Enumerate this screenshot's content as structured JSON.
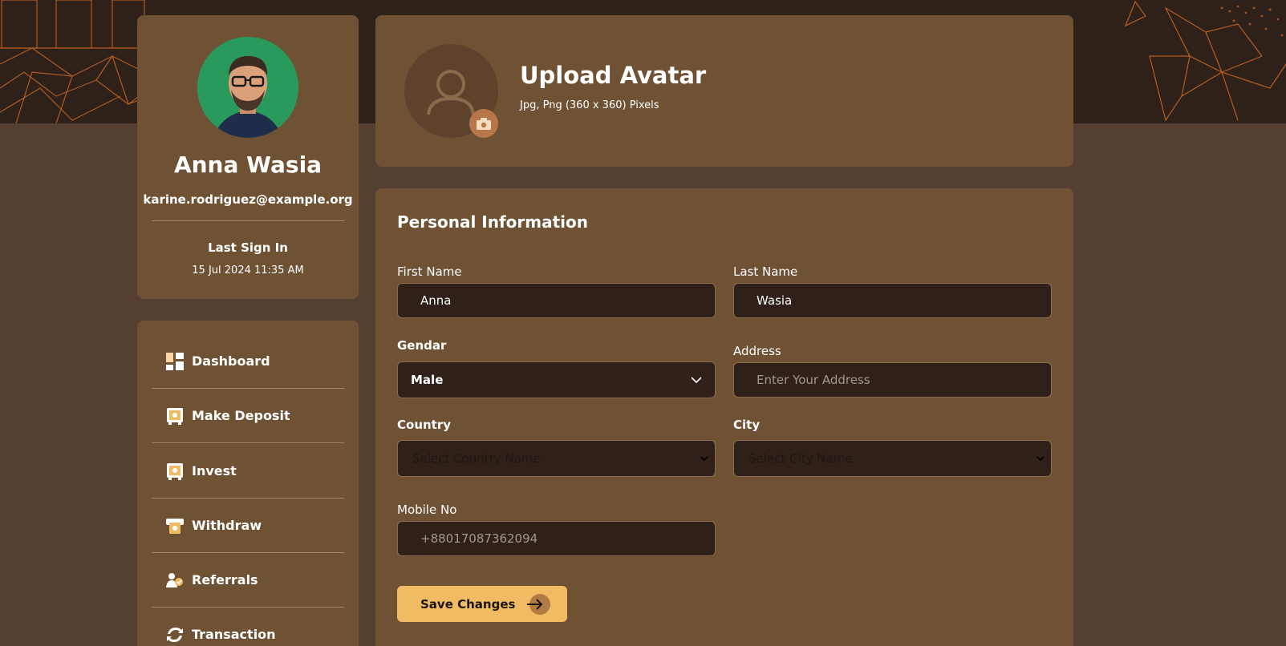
{
  "profile": {
    "name": "Anna Wasia",
    "email": "karine.rodriguez@example.org",
    "last_signin_label": "Last Sign In",
    "last_signin_value": "15 Jul 2024 11:35 AM"
  },
  "nav": {
    "items": [
      {
        "label": "Dashboard",
        "icon": "dashboard-icon"
      },
      {
        "label": "Make Deposit",
        "icon": "deposit-icon"
      },
      {
        "label": "Invest",
        "icon": "invest-icon"
      },
      {
        "label": "Withdraw",
        "icon": "withdraw-icon"
      },
      {
        "label": "Referrals",
        "icon": "referrals-icon"
      },
      {
        "label": "Transaction",
        "icon": "transaction-icon"
      }
    ]
  },
  "upload": {
    "title": "Upload Avatar",
    "hint": "Jpg, Png (360 x 360) Pixels"
  },
  "form": {
    "title": "Personal Information",
    "first_name_label": "First Name",
    "first_name_value": "Anna",
    "last_name_label": "Last Name",
    "last_name_value": "Wasia",
    "gender_label": "Gendar",
    "gender_value": "Male",
    "address_label": "Address",
    "address_placeholder": "Enter Your Address",
    "country_label": "Country",
    "country_placeholder": "Select Country Name",
    "city_label": "City",
    "city_placeholder": "Select City Name",
    "mobile_label": "Mobile No",
    "mobile_placeholder": "+88017087362094",
    "save_label": "Save Changes"
  },
  "colors": {
    "page_bg": "#553f31",
    "card_bg": "#6f5134",
    "input_bg": "#2f2119",
    "accent": "#f0bb62",
    "banner_lines": "#c8641e"
  }
}
